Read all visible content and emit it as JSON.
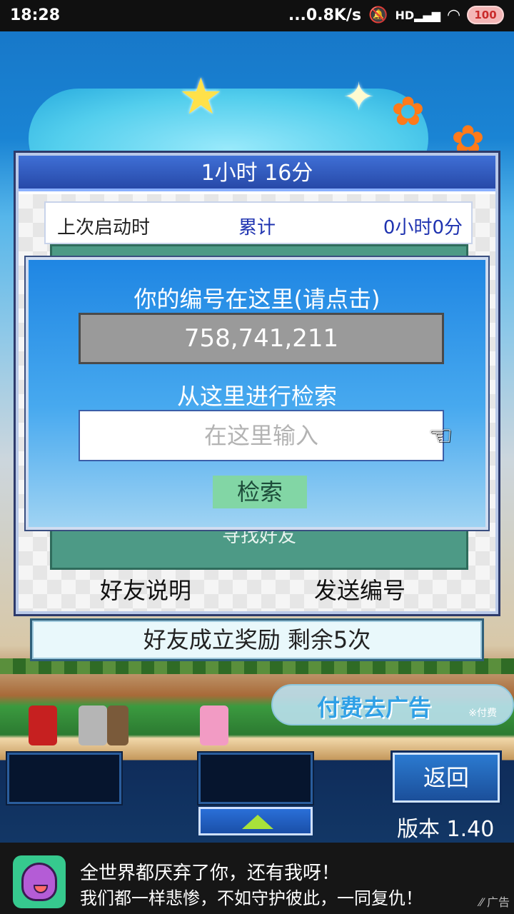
{
  "status_bar": {
    "time": "18:28",
    "network_speed": "...0.8K/s",
    "signal_label": "HD",
    "battery": "100"
  },
  "time_panel": {
    "title": "1小时 16分",
    "last_launch_label": "上次启动时",
    "cumulative_label": "累计",
    "cumulative_value": "0小时0分",
    "partial_text": "寻找好友",
    "friend_help": "好友说明",
    "send_id": "发送编号"
  },
  "search_dialog": {
    "id_heading": "你的编号在这里(请点击)",
    "id_value": "758,741,211",
    "search_heading": "从这里进行检索",
    "input_placeholder": "在这里输入",
    "search_button": "检索"
  },
  "reward_bar": {
    "text": "好友成立奖励  剩余5次"
  },
  "remove_ad": {
    "label": "付费去广告",
    "note": "※付费"
  },
  "bottom_menu": {
    "back_button": "返回",
    "version": "版本 1.40"
  },
  "ad_banner": {
    "line1": "全世界都厌弃了你，还有我呀！",
    "line2": "我们都一样悲惨，不如守护彼此，一同复仇！",
    "tag": "广告"
  }
}
